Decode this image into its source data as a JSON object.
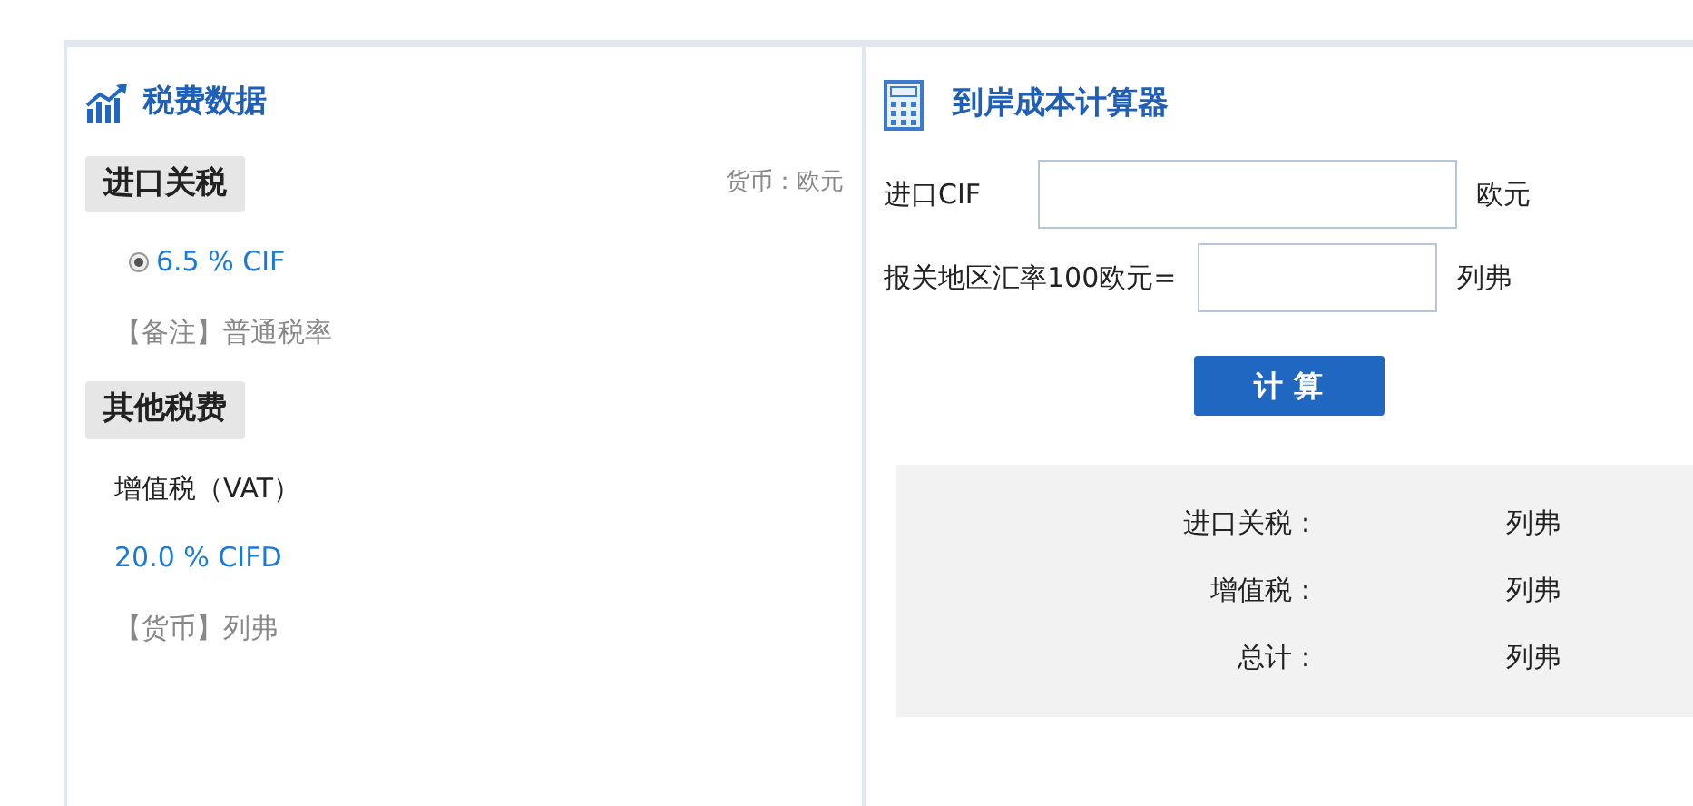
{
  "tax_panel": {
    "title": "税费数据",
    "sections": [
      {
        "heading": "进口关税",
        "currency_note": "货币：欧元",
        "items": [
          {
            "kind": "radio",
            "text": "6.5 % CIF",
            "checked": true
          },
          {
            "kind": "note",
            "text": "【备注】普通税率"
          }
        ]
      },
      {
        "heading": "其他税费",
        "items": [
          {
            "kind": "plain",
            "text": "增值税（VAT）"
          },
          {
            "kind": "rate",
            "text": "20.0 % CIFD"
          },
          {
            "kind": "note",
            "text": "【货币】列弗"
          }
        ]
      }
    ]
  },
  "calculator": {
    "title": "到岸成本计算器",
    "fields": [
      {
        "kind": "wide",
        "label": "进口CIF",
        "unit": "欧元"
      },
      {
        "kind": "narrow",
        "label": "报关地区汇率100欧元=",
        "unit": "列弗"
      }
    ],
    "button": "计 算",
    "results": [
      {
        "label": "进口关税：",
        "unit": "列弗"
      },
      {
        "label": "增值税：",
        "unit": "列弗"
      },
      {
        "label": "总计：",
        "unit": "列弗"
      }
    ]
  }
}
